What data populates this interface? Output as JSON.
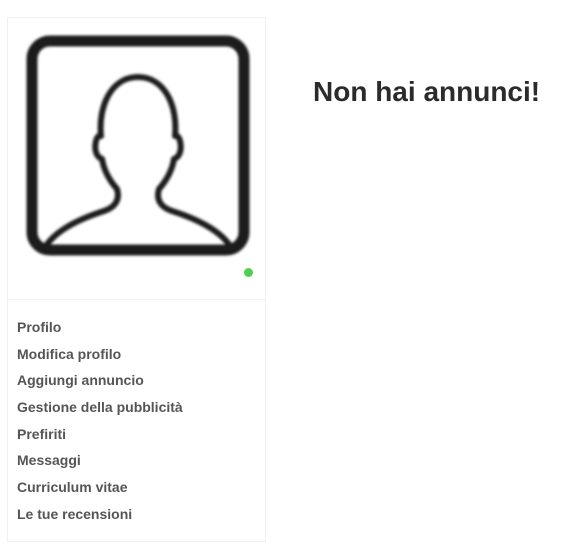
{
  "sidebar": {
    "avatar_icon": "user-silhouette-icon",
    "status_color": "#4fcf4f",
    "menu": [
      {
        "label": "Profilo"
      },
      {
        "label": "Modifica profilo"
      },
      {
        "label": "Aggiungi annuncio"
      },
      {
        "label": "Gestione della pubblicità"
      },
      {
        "label": "Prefiriti"
      },
      {
        "label": "Messaggi"
      },
      {
        "label": "Curriculum vitae"
      },
      {
        "label": "Le tue recensioni"
      }
    ]
  },
  "main": {
    "empty_message": "Non hai annunci!"
  }
}
